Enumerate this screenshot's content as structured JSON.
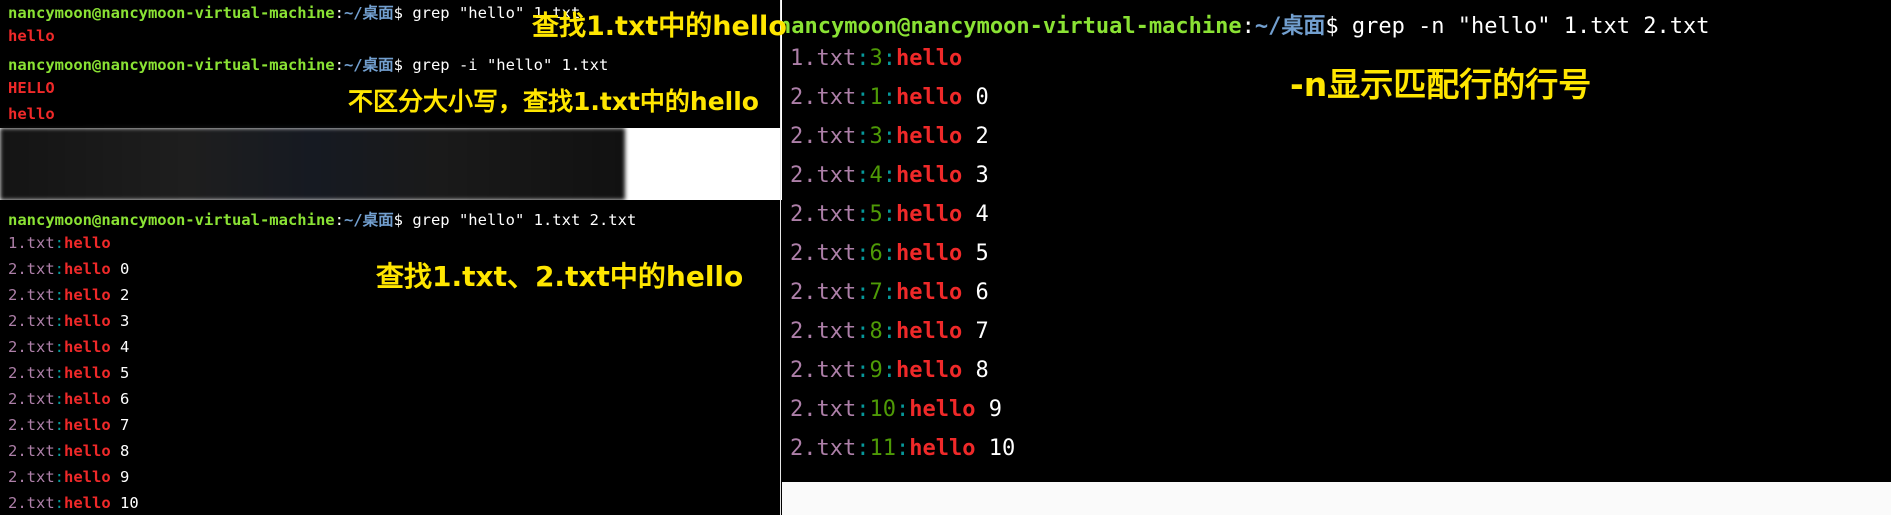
{
  "prompt": {
    "user": "nancymoon@nancymoon-virtual-machine",
    "colon": ":",
    "path": "~/桌面",
    "dollar": "$"
  },
  "left_top": {
    "cmd1": " grep \"hello\" 1.txt",
    "out1": "hello",
    "cmd2": " grep -i \"hello\" 1.txt",
    "out2a": "HELLO",
    "out2b": "hello"
  },
  "left_bottom": {
    "cmd": " grep \"hello\" 1.txt 2.txt",
    "rows": [
      {
        "file": "1.txt",
        "match": "hello",
        "rest": ""
      },
      {
        "file": "2.txt",
        "match": "hello",
        "rest": " 0"
      },
      {
        "file": "2.txt",
        "match": "hello",
        "rest": " 2"
      },
      {
        "file": "2.txt",
        "match": "hello",
        "rest": " 3"
      },
      {
        "file": "2.txt",
        "match": "hello",
        "rest": " 4"
      },
      {
        "file": "2.txt",
        "match": "hello",
        "rest": " 5"
      },
      {
        "file": "2.txt",
        "match": "hello",
        "rest": " 6"
      },
      {
        "file": "2.txt",
        "match": "hello",
        "rest": " 7"
      },
      {
        "file": "2.txt",
        "match": "hello",
        "rest": " 8"
      },
      {
        "file": "2.txt",
        "match": "hello",
        "rest": " 9"
      },
      {
        "file": "2.txt",
        "match": "hello",
        "rest": " 10"
      }
    ]
  },
  "right": {
    "user_partial": "nancymoon@nancymoon-virtual-machine",
    "cmd": " grep -n \"hello\" 1.txt 2.txt",
    "rows": [
      {
        "file": "1.txt",
        "line": "3",
        "match": "hello",
        "rest": ""
      },
      {
        "file": "2.txt",
        "line": "1",
        "match": "hello",
        "rest": " 0"
      },
      {
        "file": "2.txt",
        "line": "3",
        "match": "hello",
        "rest": " 2"
      },
      {
        "file": "2.txt",
        "line": "4",
        "match": "hello",
        "rest": " 3"
      },
      {
        "file": "2.txt",
        "line": "5",
        "match": "hello",
        "rest": " 4"
      },
      {
        "file": "2.txt",
        "line": "6",
        "match": "hello",
        "rest": " 5"
      },
      {
        "file": "2.txt",
        "line": "7",
        "match": "hello",
        "rest": " 6"
      },
      {
        "file": "2.txt",
        "line": "8",
        "match": "hello",
        "rest": " 7"
      },
      {
        "file": "2.txt",
        "line": "9",
        "match": "hello",
        "rest": " 8"
      },
      {
        "file": "2.txt",
        "line": "10",
        "match": "hello",
        "rest": " 9"
      },
      {
        "file": "2.txt",
        "line": "11",
        "match": "hello",
        "rest": " 10"
      }
    ]
  },
  "annotations": {
    "a1": "查找1.txt中的hello",
    "a2": "不区分大小写，查找1.txt中的hello",
    "a3": "查找1.txt、2.txt中的hello",
    "a4": "-n显示匹配行的行号"
  },
  "colors": {
    "annotation": "#ffe600",
    "match": "#ef2929",
    "user": "#8ae234",
    "path": "#729fcf",
    "file": "#ad7fa8",
    "line_number": "#4e9a06"
  }
}
